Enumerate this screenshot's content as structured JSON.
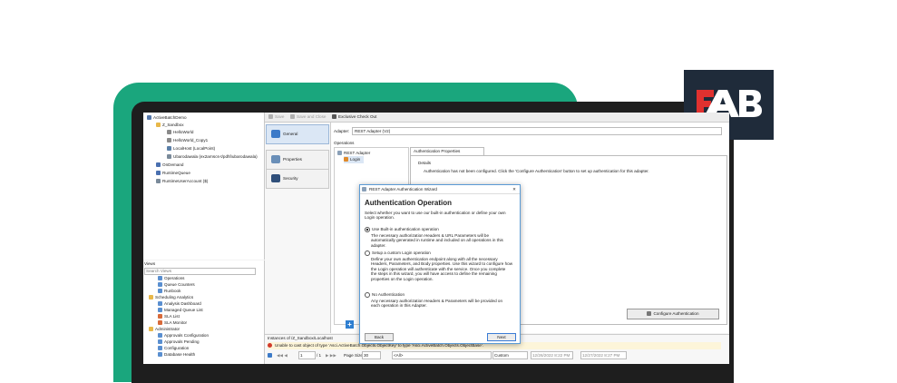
{
  "tree": {
    "items": [
      {
        "label": "ActiveBatchDemo",
        "color": "#5577aa"
      },
      {
        "label": "Z_Sandbox",
        "color": "#e8b84a"
      },
      {
        "label": "HelloWorld",
        "color": "#8a8a8a"
      },
      {
        "label": "HelloWorld_Copy1",
        "color": "#8a8a8a"
      },
      {
        "label": "LocalHost (LocalPoint)",
        "color": "#5a7fa8"
      },
      {
        "label": "Ubarodawala (ex2arnscs-t/pdhl\\ubarodawala)",
        "color": "#7a8a9a"
      },
      {
        "label": "OnDemand",
        "color": "#4a70b0"
      },
      {
        "label": "RuntimeQueue",
        "color": "#4a70b0"
      },
      {
        "label": "RuntimeUserAccount ($)",
        "color": "#7a8a9a"
      }
    ]
  },
  "views": {
    "title": "Views",
    "search_placeholder": "Search Views",
    "items": [
      {
        "label": "Operations",
        "color": "#5a8fd0"
      },
      {
        "label": "Queue Counters",
        "color": "#5a8fd0"
      },
      {
        "label": "Runbook",
        "color": "#5a8fd0"
      },
      {
        "label": "Scheduling Analytics",
        "color": "#e8b84a"
      },
      {
        "label": "Analysis Dashboard",
        "color": "#5a8fd0"
      },
      {
        "label": "Managed Queue List",
        "color": "#5a8fd0"
      },
      {
        "label": "SLA List",
        "color": "#d86a3a"
      },
      {
        "label": "SLA Monitor",
        "color": "#d86a3a"
      },
      {
        "label": "Administrator",
        "color": "#e8b84a"
      },
      {
        "label": "Approvals Configuration",
        "color": "#5a8fd0"
      },
      {
        "label": "Approvals Pending",
        "color": "#5a8fd0"
      },
      {
        "label": "Configuration",
        "color": "#5a8fd0"
      },
      {
        "label": "Database Health",
        "color": "#5a8fd0"
      }
    ]
  },
  "toolbar": {
    "save": "Save",
    "save_close": "Save and Close",
    "checkout": "Exclusive Check Out"
  },
  "nav": {
    "general": "General",
    "properties": "Properties",
    "security": "Security"
  },
  "main": {
    "adapter_label": "Adapter:",
    "adapter_value": "REST Adapter (V2)",
    "operations_label": "Operations",
    "ops_items": [
      "REST Adapter",
      "Login"
    ],
    "auth_tab": "Authentication Properties",
    "details_label": "Details",
    "details_text": "Authentication has not been configured. Click the 'Configure Authentication' button to set up authentication for this adapter.",
    "configure_button": "Configure Authentication",
    "plus": "+"
  },
  "instances": {
    "title": "Instances of /Z_Sandbox/Localhost",
    "error": "Unable to cast object of type 'Asci.ActiveBatch.Objects.ObjectKey' to type 'Asci.ActiveBatch.Objects.ObjectBase'.",
    "page_current": "1",
    "page_total": "/ 1",
    "page_size_label": "Page Size",
    "page_size": "30",
    "filter_all": "<All>",
    "range": "Custom",
    "date_from": "12/26/2022 8:22 PM",
    "date_to": "12/27/2022 8:27 PM"
  },
  "dialog": {
    "title": "REST Adapter Authentication Wizard",
    "close": "✕",
    "heading": "Authentication Operation",
    "intro": "Select whether you want to use our built-in authentication or define your own Login operation.",
    "opt1_label": "Use Built-in authentication operation",
    "opt1_desc": "The necessary authorization Headers & URL Parameters will be automatically generated in runtime and included on all operations in this adapter.",
    "opt2_label": "Setup a custom Login operation",
    "opt2_desc": "Define your own authentication endpoint along with all the necessary Headers, Parameters, and Body properties. Use this wizard to configure how the Login operation will authenticate with the service. Once you complete the steps in this wizard, you will have access to define the remaining properties on the Login operation.",
    "opt3_label": "No Authentication",
    "opt3_desc": "Any necessary authorization Headers & Parameters will be provided on each operation in this Adapter.",
    "back": "Back",
    "next": "Next"
  },
  "colors": {
    "brand_green": "#1aa67d",
    "logo_bg": "#1f2b3a",
    "logo_red": "#e0312f",
    "accent_blue": "#2f7fd1"
  }
}
